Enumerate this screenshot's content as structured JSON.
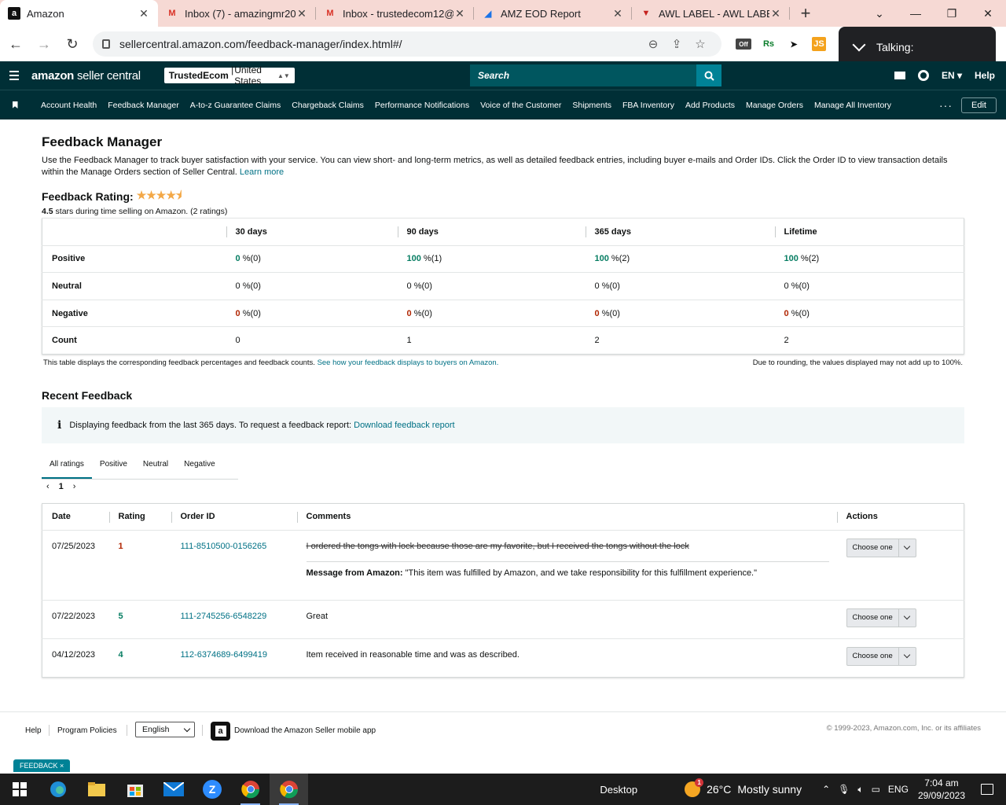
{
  "browser": {
    "tabs": [
      {
        "title": "Amazon",
        "icon": "amazon-icon",
        "active": true
      },
      {
        "title": "Inbox (7) - amazingmr20",
        "icon": "gmail-icon"
      },
      {
        "title": "Inbox - trustedecom12@",
        "icon": "gmail-icon"
      },
      {
        "title": "AMZ EOD Report",
        "icon": "docs-icon"
      },
      {
        "title": "AWL LABEL - AWL LABEL",
        "icon": "awl-icon"
      }
    ],
    "url": "sellercentral.amazon.com/feedback-manager/index.html#/",
    "popup": "Talking:",
    "ext_off_badge": "Off",
    "ext_rs": "Rs",
    "ext_js": "JS"
  },
  "header": {
    "logo_main": "amazon",
    "logo_sub": "seller central",
    "marketplace_store": "TrustedEcom",
    "marketplace_country": "United States",
    "search_placeholder": "Search",
    "language": "EN",
    "help": "Help"
  },
  "nav": {
    "items": [
      "Account Health",
      "Feedback Manager",
      "A-to-z Guarantee Claims",
      "Chargeback Claims",
      "Performance Notifications",
      "Voice of the Customer",
      "Shipments",
      "FBA Inventory",
      "Add Products",
      "Manage Orders",
      "Manage All Inventory"
    ],
    "more": "···",
    "edit": "Edit"
  },
  "page": {
    "title": "Feedback Manager",
    "intro": "Use the Feedback Manager to track buyer satisfaction with your service. You can view short- and long-term metrics, as well as detailed feedback entries, including buyer e-mails and Order IDs. Click the Order ID to view transaction details within the Manage Orders section of Seller Central.",
    "learn_more": "Learn more",
    "rating_label": "Feedback Rating:",
    "rating_value": 4.5,
    "rating_stars": "4.5",
    "rating_desc": "stars during time selling on Amazon. (2 ratings)"
  },
  "metrics": {
    "headers": [
      "",
      "30 days",
      "90 days",
      "365 days",
      "Lifetime"
    ],
    "rows": [
      {
        "label": "Positive",
        "cells": [
          {
            "num": "0",
            "pct": "%(0)",
            "cls": "green"
          },
          {
            "num": "100",
            "pct": "%(1)",
            "cls": "green"
          },
          {
            "num": "100",
            "pct": "%(2)",
            "cls": "green"
          },
          {
            "num": "100",
            "pct": "%(2)",
            "cls": "green"
          }
        ]
      },
      {
        "label": "Neutral",
        "cells": [
          {
            "num": "0",
            "pct": "%(0)",
            "cls": ""
          },
          {
            "num": "0",
            "pct": "%(0)",
            "cls": ""
          },
          {
            "num": "0",
            "pct": "%(0)",
            "cls": ""
          },
          {
            "num": "0",
            "pct": "%(0)",
            "cls": ""
          }
        ]
      },
      {
        "label": "Negative",
        "cells": [
          {
            "num": "0",
            "pct": "%(0)",
            "cls": "red"
          },
          {
            "num": "0",
            "pct": "%(0)",
            "cls": "red"
          },
          {
            "num": "0",
            "pct": "%(0)",
            "cls": "red"
          },
          {
            "num": "0",
            "pct": "%(0)",
            "cls": "red"
          }
        ]
      },
      {
        "label": "Count",
        "cells": [
          {
            "num": "0",
            "pct": "",
            "cls": ""
          },
          {
            "num": "1",
            "pct": "",
            "cls": ""
          },
          {
            "num": "2",
            "pct": "",
            "cls": ""
          },
          {
            "num": "2",
            "pct": "",
            "cls": ""
          }
        ]
      }
    ],
    "note_left": "This table displays the corresponding feedback percentages and feedback counts.",
    "note_link": "See how your feedback displays to buyers on Amazon.",
    "note_right": "Due to rounding, the values displayed may not add up to 100%."
  },
  "recent": {
    "title": "Recent Feedback",
    "info": "Displaying feedback from the last 365 days. To request a feedback report:",
    "info_link": "Download feedback report",
    "tabs": [
      "All ratings",
      "Positive",
      "Neutral",
      "Negative"
    ],
    "page": "1",
    "columns": [
      "Date",
      "Rating",
      "Order ID",
      "Comments",
      "Actions"
    ],
    "rows": [
      {
        "date": "07/25/2023",
        "rating": "1",
        "rating_cls": "red",
        "order": "111-8510500-0156265",
        "comment": "I ordered the tongs with lock because those are my favorite, but I received the tongs without the lock",
        "struck": true,
        "msg_label": "Message from Amazon:",
        "msg": "\"This item was fulfilled by Amazon, and we take responsibility for this fulfillment experience.\"",
        "action": "Choose one"
      },
      {
        "date": "07/22/2023",
        "rating": "5",
        "rating_cls": "green",
        "order": "111-2745256-6548229",
        "comment": "Great",
        "struck": false,
        "action": "Choose one"
      },
      {
        "date": "04/12/2023",
        "rating": "4",
        "rating_cls": "green",
        "order": "112-6374689-6499419",
        "comment": "Item received in reasonable time and was as described.",
        "struck": false,
        "action": "Choose one"
      }
    ]
  },
  "footer": {
    "help": "Help",
    "policies": "Program Policies",
    "language": "English",
    "app": "Download the Amazon Seller mobile app",
    "copyright": "© 1999-2023, Amazon.com, Inc. or its affiliates",
    "feedback": "FEEDBACK ×"
  },
  "taskbar": {
    "desktop": "Desktop",
    "temp": "26°C",
    "weather": "Mostly sunny",
    "weather_badge": "1",
    "lang": "ENG",
    "time": "7:04 am",
    "date": "29/09/2023"
  },
  "colors": {
    "teal": "#002f36",
    "link": "#007185",
    "positive": "#067d62",
    "negative": "#b12704",
    "star": "#f3a847"
  }
}
